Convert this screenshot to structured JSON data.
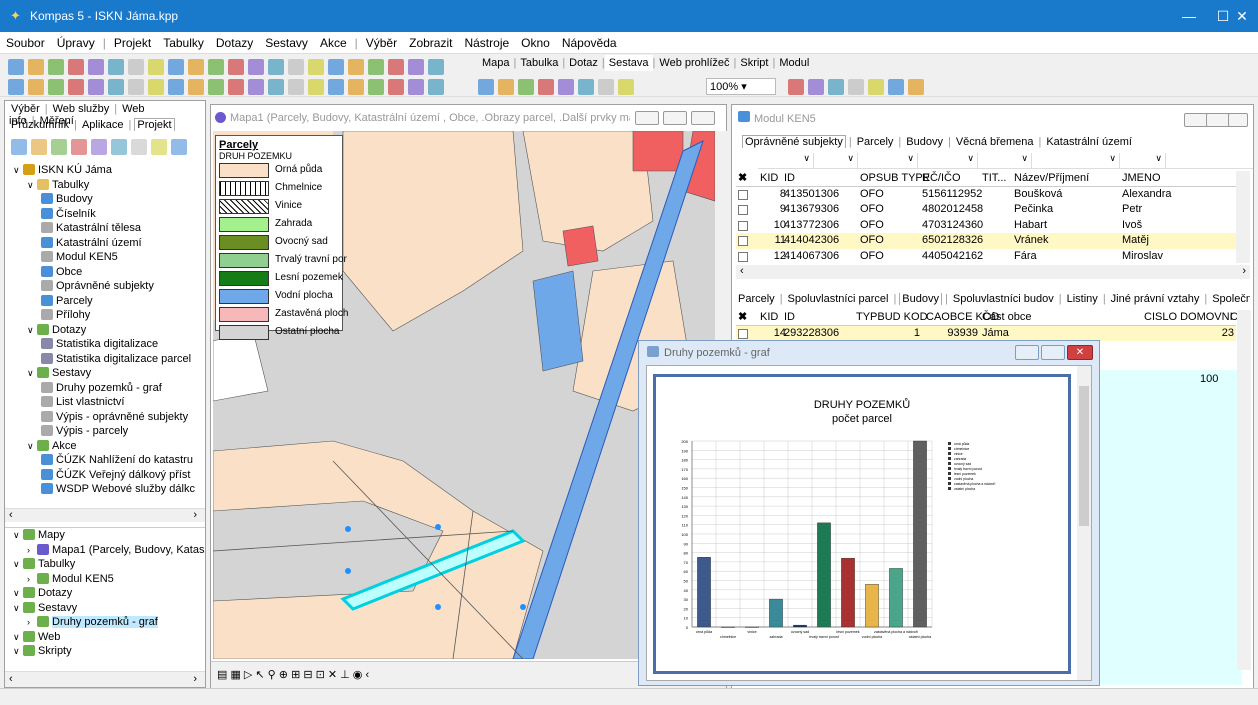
{
  "window": {
    "title": "Kompas 5 - ISKN Jáma.kpp"
  },
  "menu": [
    "Soubor",
    "Úpravy",
    "|",
    "Projekt",
    "Tabulky",
    "Dotazy",
    "Sestavy",
    "Akce",
    "|",
    "Výběr",
    "Zobrazit",
    "Nástroje",
    "Okno",
    "Nápověda"
  ],
  "view_tabs": [
    "Mapa",
    "Tabulka",
    "Dotaz",
    "Sestava",
    "Web prohlížeč",
    "Skript",
    "Modul"
  ],
  "zoom": "100%",
  "left": {
    "tabs_row1": [
      "Výběr",
      "Web služby",
      "Web info",
      "Měření"
    ],
    "tabs_row2": [
      "Průzkumník",
      "Aplikace",
      "Projekt"
    ],
    "tree": [
      "ISKN KÚ Jáma",
      "Tabulky",
      "Budovy",
      "Číselník",
      "Katastrální tělesa",
      "Katastrální území",
      "Modul KEN5",
      "Obce",
      "Oprávněné subjekty",
      "Parcely",
      "Přílohy",
      "Dotazy",
      "Statistika digitalizace",
      "Statistika digitalizace parcel",
      "Sestavy",
      "Druhy pozemků - graf",
      "List vlastnictví",
      "Výpis - oprávněné subjekty",
      "Výpis - parcely",
      "Akce",
      "ČÚZK Nahlížení do katastru",
      "ČÚZK Veřejný dálkový příst",
      "WSDP Webové služby dálkc"
    ],
    "tree2": [
      "Mapy",
      "Mapa1 (Parcely, Budovy, Katas",
      "Tabulky",
      "Modul KEN5",
      "Dotazy",
      "Sestavy",
      "Druhy pozemků - graf",
      "Web",
      "Skripty"
    ]
  },
  "map": {
    "title": "Mapa1 (Parcely, Budovy, Katastrální území , Obce, .Obrazy parcel, .Další prvky mapy, .O...",
    "legend_title": "Parcely",
    "legend_subtitle": "DRUH POZEMKU",
    "legend": [
      {
        "label": "Orná půda",
        "color": "#fbe0c8"
      },
      {
        "label": "Chmelnice",
        "color": "#ffffff"
      },
      {
        "label": "Vinice",
        "color": "#ffffff"
      },
      {
        "label": "Zahrada",
        "color": "#a3f08c"
      },
      {
        "label": "Ovocný sad",
        "color": "#6b8e23"
      },
      {
        "label": "Trvalý travní por",
        "color": "#8fcf8f"
      },
      {
        "label": "Lesní pozemek",
        "color": "#167c16"
      },
      {
        "label": "Vodní plocha",
        "color": "#6fa8e8"
      },
      {
        "label": "Zastavěná ploch",
        "color": "#f6b8b8"
      },
      {
        "label": "Ostatní plocha",
        "color": "#d4d4d4"
      }
    ]
  },
  "ken": {
    "title": "Modul KEN5",
    "tabs1": [
      "Oprávněné subjekty",
      "Parcely",
      "Budovy",
      "Věcná břemena",
      "Katastrální území"
    ],
    "headers1": [
      "KID",
      "ID",
      "OPSUB TYPE",
      "RČ/IČO",
      "TIT...",
      "Název/Příjmení",
      "JMENO"
    ],
    "rows1": [
      [
        "8",
        "413501306",
        "OFO",
        "5156112952",
        "",
        "Boušková",
        "Alexandra"
      ],
      [
        "9",
        "413679306",
        "OFO",
        "4802012458",
        "",
        "Pečinka",
        "Petr"
      ],
      [
        "10",
        "413772306",
        "OFO",
        "4703124360",
        "",
        "Habart",
        "Ivoš"
      ],
      [
        "11",
        "414042306",
        "OFO",
        "6502128326",
        "",
        "Vránek",
        "Matěj"
      ],
      [
        "12",
        "414067306",
        "OFO",
        "4405042162",
        "",
        "Fára",
        "Miroslav"
      ]
    ],
    "tabs2": [
      "Parcely",
      "Spoluvlastníci parcel",
      "Budovy",
      "Spoluvlastníci budov",
      "Listiny",
      "Jiné právní vztahy",
      "Společné jmění manže"
    ],
    "headers2": [
      "KID",
      "ID",
      "TYPBUD KOD",
      "CAOBCE KOD",
      "Část obce",
      "CISLO DOMOVNI",
      "C"
    ],
    "rows2": [
      [
        "14",
        "293228306",
        "1",
        "93939",
        "Jáma",
        "23"
      ]
    ],
    "extra_value": "100"
  },
  "graf": {
    "title": "Druhy pozemků - graf",
    "chart_title": "DRUHY POZEMKŮ",
    "chart_subtitle": "počet parcel"
  },
  "chart_data": {
    "type": "bar",
    "title": "DRUHY POZEMKŮ",
    "subtitle": "počet parcel",
    "categories": [
      "orná půda",
      "chmelnice",
      "vinice",
      "zahrada",
      "ovocný sad",
      "trvalý travní porost",
      "lesní pozemek",
      "vodní plocha",
      "zastavěná plocha a nádvoří",
      "ostatní plocha"
    ],
    "values": [
      75,
      0,
      0,
      30,
      2,
      112,
      74,
      46,
      63,
      200
    ],
    "colors": [
      "#3c5a8c",
      "#f4c542",
      "#d9d9d9",
      "#3a8a9a",
      "#1e2f6a",
      "#1e7a55",
      "#a83232",
      "#e8b54a",
      "#4aa58a",
      "#606060"
    ],
    "ylim": [
      0,
      200
    ],
    "grid": true,
    "legend_position": "right"
  },
  "icons": {
    "app": "compass-icon",
    "close": "close-icon"
  }
}
